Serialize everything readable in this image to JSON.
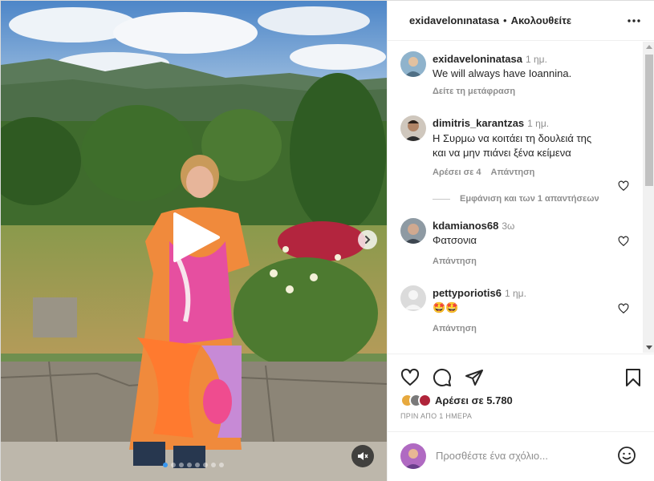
{
  "post": {
    "username": "exidavelonınatasa",
    "follow_sep": "•",
    "follow_label": "Ακολουθείτε"
  },
  "comments": [
    {
      "username": "exidaveloninatasa",
      "time": "1 ημ.",
      "text_lines": [
        "We will always have Ioannina."
      ],
      "translate_label": "Δείτε τη μετάφραση"
    },
    {
      "username": "dimitris_karantzas",
      "time": "1 ημ.",
      "text_lines": [
        "Η Συρμω να κοιτάει τη δουλειά της",
        "και να μην πιάνει ξένα κείμενα"
      ],
      "likes_label": "Αρέσει σε 4",
      "reply_label": "Απάντηση",
      "view_replies": "Εμφάνιση και των 1 απαντήσεων"
    },
    {
      "username": "kdamianos68",
      "time": "3ω",
      "text_lines": [
        "Φατσονια"
      ],
      "reply_label": "Απάντηση"
    },
    {
      "username": "pettyporiotis6",
      "time": "1 ημ.",
      "text_lines": [
        "🤩🤩"
      ],
      "reply_label": "Απάντηση"
    }
  ],
  "actions": {
    "likes_label": "Αρέσει σε 5.780",
    "posted_label": "ΠΡΙΝ ΑΠΟ 1 ΗΜΕΡΑ"
  },
  "composer": {
    "placeholder": "Προσθέστε ένα σχόλιο..."
  },
  "icons": {
    "more": "more-horizontal-icon",
    "heart": "heart-icon",
    "comment": "comment-icon",
    "share": "send-icon",
    "save": "bookmark-icon",
    "emoji": "emoji-icon",
    "play": "play-icon",
    "next": "chevron-right-icon",
    "mute": "speaker-muted-icon"
  },
  "carousel": {
    "slide_count": 8,
    "active_index": 0
  },
  "colors": {
    "accent_blue": "#3897f0",
    "text": "#262626",
    "muted": "#8e8e8e"
  }
}
